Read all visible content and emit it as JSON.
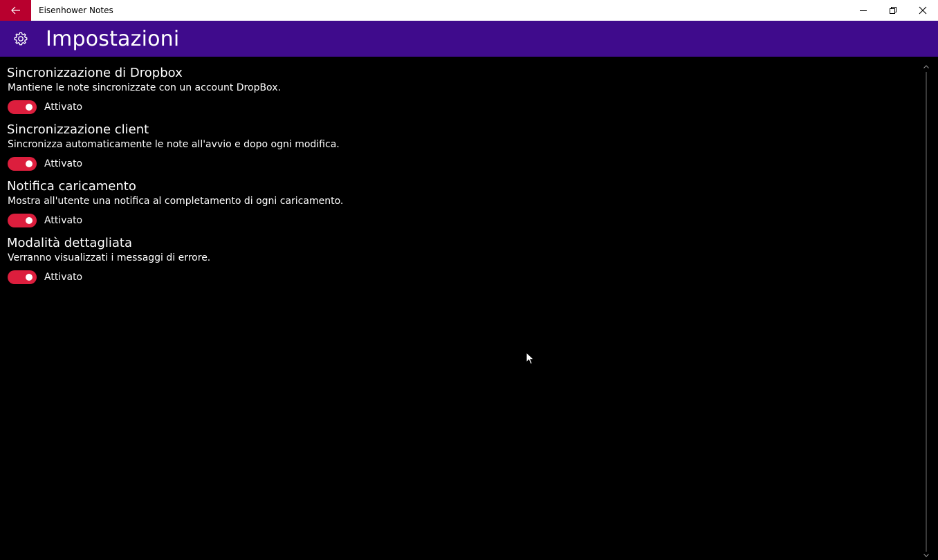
{
  "window": {
    "title": "Eisenhower Notes",
    "back_icon": "back-arrow-icon",
    "controls": [
      "minimize-icon",
      "restore-icon",
      "close-icon"
    ]
  },
  "header": {
    "icon": "gear-icon",
    "title": "Impostazioni",
    "background": "#3f0b8c"
  },
  "settings": [
    {
      "title": "Sincronizzazione di Dropbox",
      "description": "Mantiene le note sincronizzate con un account DropBox.",
      "toggle_label": "Attivato",
      "on": true
    },
    {
      "title": "Sincronizzazione client",
      "description": "Sincronizza automaticamente le note all'avvio e dopo ogni modifica.",
      "toggle_label": "Attivato",
      "on": true
    },
    {
      "title": "Notifica caricamento",
      "description": "Mostra all'utente una notifica al completamento di ogni caricamento.",
      "toggle_label": "Attivato",
      "on": true
    },
    {
      "title": "Modalità dettagliata",
      "description": "Verranno visualizzati i messaggi di errore.",
      "toggle_label": "Attivato",
      "on": true
    }
  ],
  "colors": {
    "accent": "#dc1e3d",
    "back_button": "#b8002e",
    "background": "#000000"
  }
}
